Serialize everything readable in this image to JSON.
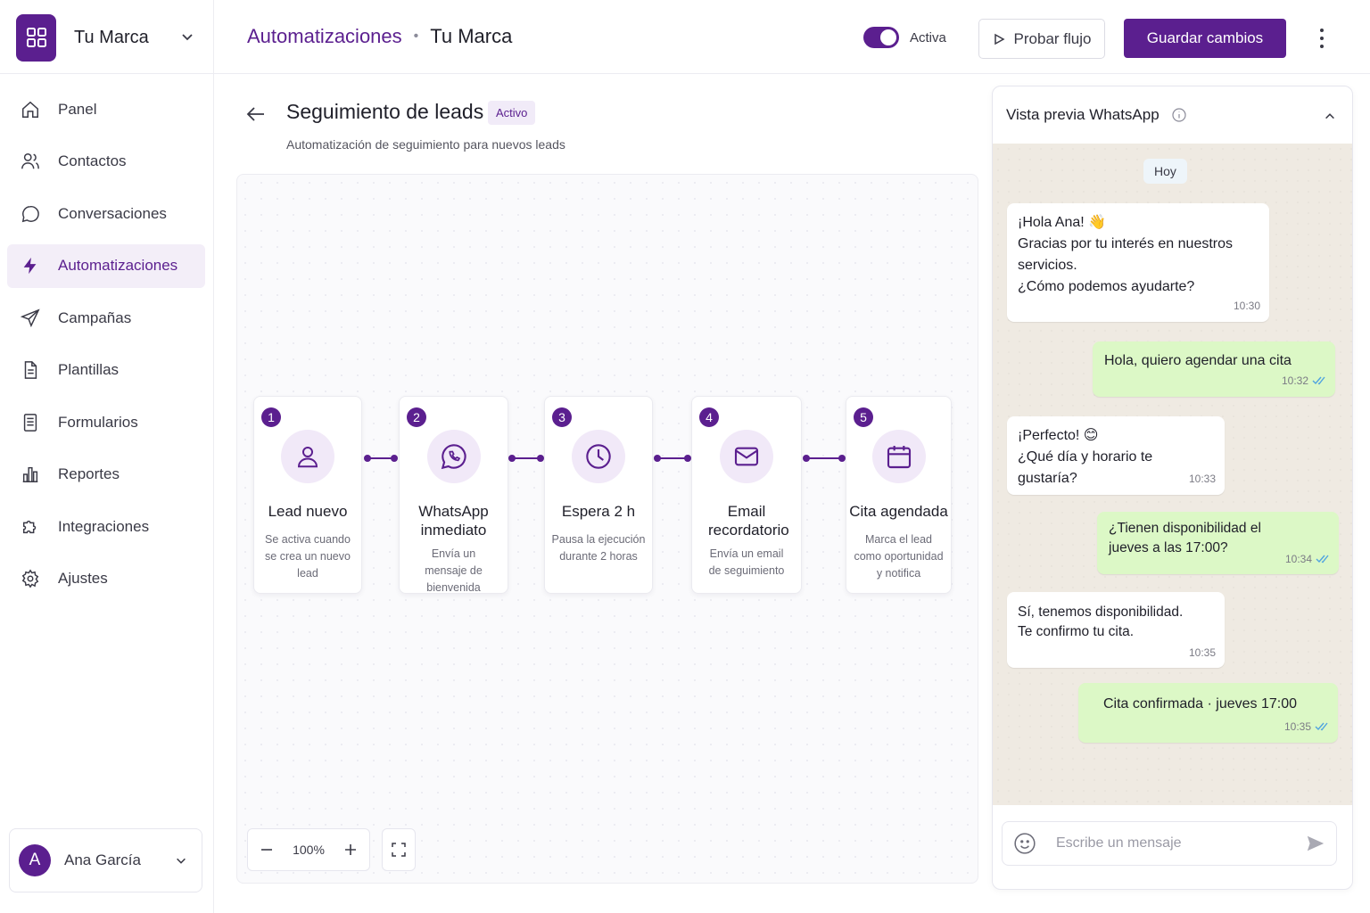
{
  "brand": {
    "name": "Tu Marca"
  },
  "sidebar": {
    "items": [
      {
        "label": "Panel",
        "icon": "home-icon"
      },
      {
        "label": "Contactos",
        "icon": "users-icon"
      },
      {
        "label": "Conversaciones",
        "icon": "chat-bubble-icon"
      },
      {
        "label": "Automatizaciones",
        "icon": "lightning-icon",
        "active": true
      },
      {
        "label": "Campañas",
        "icon": "send-icon"
      },
      {
        "label": "Plantillas",
        "icon": "document-icon"
      },
      {
        "label": "Formularios",
        "icon": "form-icon"
      },
      {
        "label": "Reportes",
        "icon": "bar-chart-icon"
      },
      {
        "label": "Integraciones",
        "icon": "puzzle-icon"
      },
      {
        "label": "Ajustes",
        "icon": "gear-icon"
      }
    ]
  },
  "user": {
    "initial": "A",
    "name": "Ana García"
  },
  "header": {
    "breadcrumb_link": "Automatizaciones",
    "breadcrumb_separator": "•",
    "breadcrumb_current": "Tu Marca",
    "toggle_label": "Activa",
    "toggle_on": true,
    "test_button": "Probar flujo",
    "save_button": "Guardar cambios"
  },
  "flow": {
    "title": "Seguimiento de leads",
    "status_badge": "Activo",
    "subtitle": "Automatización de seguimiento para nuevos leads",
    "zoom": "100%",
    "steps": [
      {
        "number": "1",
        "title": "Lead nuevo",
        "description": "Se activa cuando se crea un nuevo lead",
        "icon": "user-icon"
      },
      {
        "number": "2",
        "title": "WhatsApp inmediato",
        "description": "Envía un mensaje de bienvenida",
        "icon": "whatsapp-icon"
      },
      {
        "number": "3",
        "title": "Espera 2 h",
        "description": "Pausa la ejecución durante 2 horas",
        "icon": "clock-icon"
      },
      {
        "number": "4",
        "title": "Email recordatorio",
        "description": "Envía un email de seguimiento",
        "icon": "mail-icon"
      },
      {
        "number": "5",
        "title": "Cita agendada",
        "description": "Marca el lead como oportunidad y notifica",
        "icon": "calendar-icon"
      }
    ]
  },
  "whatsapp_preview": {
    "title": "Vista previa WhatsApp",
    "day_label": "Hoy",
    "messages": [
      {
        "direction": "in",
        "text": "¡Hola Ana! 👋\nGracias por tu interés en nuestros servicios.\n¿Cómo podemos ayudarte?",
        "time": "10:30"
      },
      {
        "direction": "out",
        "text": "Hola, quiero agendar una cita",
        "time": "10:32"
      },
      {
        "direction": "in",
        "text": "¡Perfecto! 😊\n¿Qué día y horario te gustaría?",
        "time": "10:33"
      },
      {
        "direction": "out",
        "text": "¿Tienen disponibilidad el jueves a las 17:00?",
        "time": "10:34"
      },
      {
        "direction": "in",
        "text": "Sí, tenemos disponibilidad.\nTe confirmo tu cita.",
        "time": "10:35"
      },
      {
        "direction": "out",
        "text": "Cita confirmada · jueves 17:00",
        "time": "10:35"
      }
    ],
    "input_placeholder": "Escribe un mensaje"
  },
  "colors": {
    "brand": "#5b1f8f",
    "brand_light": "#f1e9f8",
    "outgoing_bubble": "#dcf8c6",
    "chat_background": "#efeae2",
    "read_ticks": "#4fa3e0"
  }
}
